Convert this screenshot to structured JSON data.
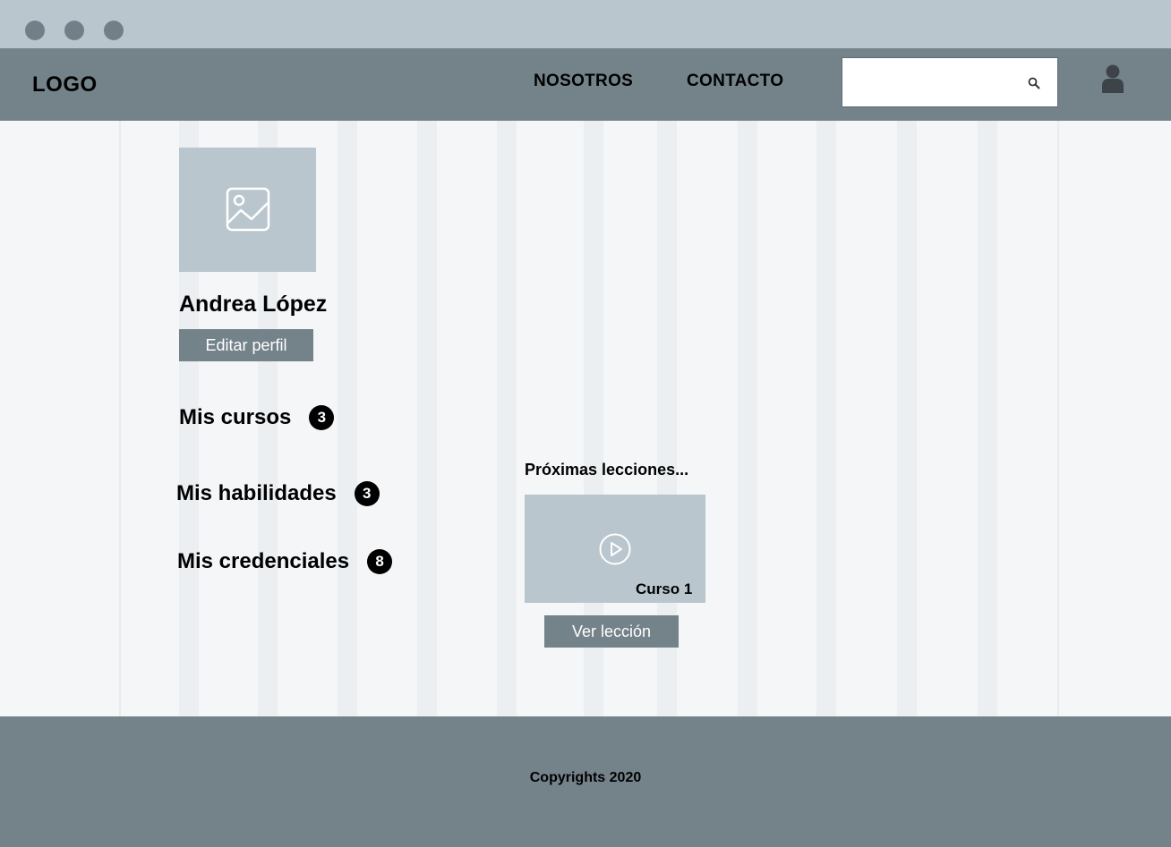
{
  "header": {
    "logo": "LOGO",
    "nav": [
      "NOSOTROS",
      "CONTACTO"
    ],
    "search_value": ""
  },
  "profile": {
    "name": "Andrea López",
    "edit_label": "Editar perfil"
  },
  "sidebar": {
    "items": [
      {
        "label": "Mis cursos",
        "count": "3"
      },
      {
        "label": "Mis habilidades",
        "count": "3"
      },
      {
        "label": "Mis credenciales",
        "count": "8"
      }
    ]
  },
  "lessons": {
    "title": "Próximas lecciones...",
    "course_label": "Curso 1",
    "view_label": "Ver lección"
  },
  "footer": {
    "copyright": "Copyrights 2020"
  },
  "colors": {
    "titlebar": "#bac6ce",
    "navbar": "#74828a",
    "content_bg": "#f4f6f8",
    "placeholder": "#bac6ce",
    "button": "#74828a",
    "badge": "#000000"
  },
  "icons": [
    "window-control-icon",
    "search-icon",
    "user-icon",
    "image-placeholder-icon",
    "play-icon"
  ]
}
